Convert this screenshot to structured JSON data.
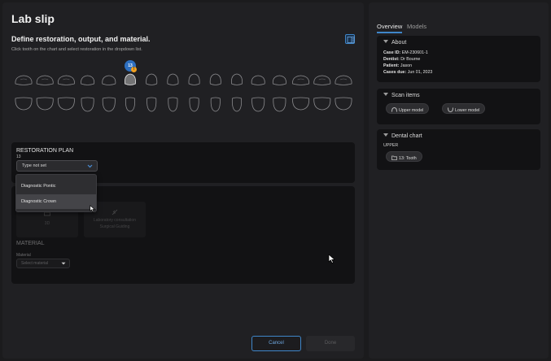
{
  "main": {
    "title": "Lab slip",
    "define_title": "Define restoration, output, and material.",
    "define_subtitle": "Click tooth on the chart and select restoration in the dropdown list.",
    "selected_tooth_badge": "13",
    "warning_mark": "!"
  },
  "restoration_plan": {
    "title": "RESTORATION PLAN",
    "tooth_label": "13",
    "type_select_value": "Type not set",
    "dropdown_options": [
      "Diagnostic Pontic",
      "Diagnostic Crown"
    ],
    "hovered_option": "Diagnostic Crown"
  },
  "output_section": {
    "card_1_label": "3D",
    "card_2_line_1": "Laboratory consultation",
    "card_2_line_2": "Surgical Guiding"
  },
  "material": {
    "title": "MATERIAL",
    "field_label": "Material",
    "placeholder": "Select material"
  },
  "footer": {
    "cancel_label": "Cancel",
    "done_label": "Done"
  },
  "sidebar": {
    "tabs": [
      "Overview",
      "Models"
    ],
    "active_tab": "Overview",
    "about": {
      "title": "About",
      "case_id_label": "Case ID:",
      "case_id": "EM-230601-1",
      "dentist_label": "Dentist:",
      "dentist": "Dr Bourne",
      "patient_label": "Patient:",
      "patient": "Jason",
      "cases_due_label": "Cases due:",
      "cases_due": "Jun 01, 2023"
    },
    "scan_items": {
      "title": "Scan items",
      "items": [
        "Upper model",
        "Lower model"
      ]
    },
    "dental_chart": {
      "title": "Dental chart",
      "arch_label": "UPPER",
      "tooth_chip": "13: Tooth"
    }
  },
  "colors": {
    "accent": "#3f86c9",
    "background": "#1b1b1d",
    "panel": "#202023",
    "card": "#121214",
    "warning": "#f0a020"
  }
}
